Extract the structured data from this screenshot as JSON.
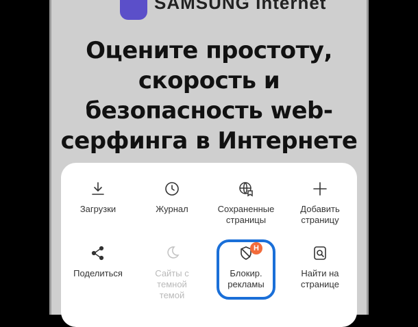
{
  "app": {
    "logo_text": "SAMSUNG Internet",
    "logo_color": "#5b4fc9"
  },
  "headline": {
    "lines": [
      "Оцените простоту,",
      "скорость и",
      "безопасность web-",
      "серфинга в Интернете"
    ]
  },
  "menu": {
    "items": [
      {
        "label": "Загрузки",
        "icon": "download-icon",
        "enabled": true
      },
      {
        "label": "Журнал",
        "icon": "clock-icon",
        "enabled": true
      },
      {
        "label": "Сохраненные\nстраницы",
        "icon": "saved-globe-icon",
        "enabled": true
      },
      {
        "label": "Добавить\nстраницу",
        "icon": "plus-icon",
        "enabled": true
      },
      {
        "label": "Поделиться",
        "icon": "share-icon",
        "enabled": true
      },
      {
        "label": "Сайты с\nтемной\nтемой",
        "icon": "moon-icon",
        "enabled": false
      },
      {
        "label": "Блокир.\nрекламы",
        "icon": "shield-icon",
        "enabled": true,
        "badge": "H"
      },
      {
        "label": "Найти на\nстранице",
        "icon": "find-page-icon",
        "enabled": true
      }
    ],
    "highlight_color": "#1a6fd8",
    "badge_color": "#f26b3a"
  }
}
